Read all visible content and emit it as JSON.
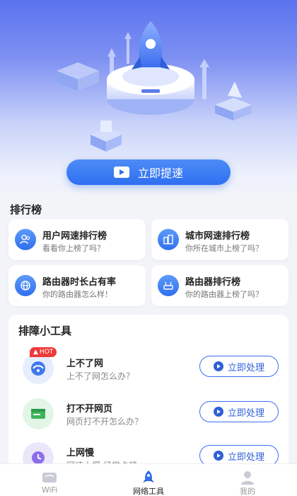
{
  "hero": {
    "button_label": "立即提速"
  },
  "ranking": {
    "title": "排行榜",
    "items": [
      {
        "title": "用户网速排行榜",
        "subtitle": "看看你上榜了吗？",
        "icon": "users-icon"
      },
      {
        "title": "城市网速排行榜",
        "subtitle": "你所在城市上榜了吗？",
        "icon": "city-icon"
      },
      {
        "title": "路由器时长占有率",
        "subtitle": "你的路由器怎么样！",
        "icon": "globe-icon"
      },
      {
        "title": "路由器排行榜",
        "subtitle": "你的路由器上榜了吗？",
        "icon": "router-icon"
      }
    ]
  },
  "tools": {
    "title": "排障小工具",
    "hot_badge": "HOT",
    "items": [
      {
        "title": "上不了网",
        "subtitle": "上不了网怎么办？",
        "action": "立即处理",
        "icon": "no-network-icon"
      },
      {
        "title": "打不开网页",
        "subtitle": "网页打不开怎么办？",
        "action": "立即处理",
        "icon": "webpage-icon"
      },
      {
        "title": "上网慢",
        "subtitle": "网速太慢,经常卡顿",
        "action": "立即处理",
        "icon": "slow-clock-icon"
      }
    ]
  },
  "tabbar": {
    "items": [
      {
        "label": "WiFi"
      },
      {
        "label": "网络工具"
      },
      {
        "label": "我的"
      }
    ]
  },
  "colors": {
    "accent": "#2f6ff0",
    "hot": "#ef3a3a",
    "background": "#f2f4f8"
  }
}
